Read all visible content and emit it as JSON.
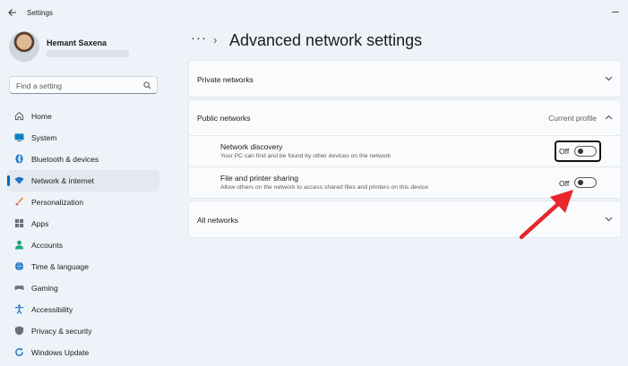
{
  "window": {
    "title": "Settings"
  },
  "profile": {
    "name": "Hemant Saxena"
  },
  "search": {
    "placeholder": "Find a setting"
  },
  "sidebar": {
    "items": [
      {
        "label": "Home",
        "icon": "home-icon"
      },
      {
        "label": "System",
        "icon": "monitor-icon"
      },
      {
        "label": "Bluetooth & devices",
        "icon": "bluetooth-icon"
      },
      {
        "label": "Network & internet",
        "icon": "wifi-icon",
        "active": true
      },
      {
        "label": "Personalization",
        "icon": "brush-icon"
      },
      {
        "label": "Apps",
        "icon": "apps-icon"
      },
      {
        "label": "Accounts",
        "icon": "person-icon"
      },
      {
        "label": "Time & language",
        "icon": "globe-icon"
      },
      {
        "label": "Gaming",
        "icon": "controller-icon"
      },
      {
        "label": "Accessibility",
        "icon": "accessibility-icon"
      },
      {
        "label": "Privacy & security",
        "icon": "shield-icon"
      },
      {
        "label": "Windows Update",
        "icon": "update-icon"
      }
    ]
  },
  "header": {
    "breadcrumb_more": "···",
    "breadcrumb_sep": "›",
    "title": "Advanced network settings"
  },
  "sections": {
    "private": {
      "label": "Private networks"
    },
    "public": {
      "label": "Public networks",
      "badge": "Current profile",
      "settings": [
        {
          "title": "Network discovery",
          "description": "Your PC can find and be found by other devices on the network",
          "state": "Off"
        },
        {
          "title": "File and printer sharing",
          "description": "Allow others on the network to access shared files and printers on this device",
          "state": "Off"
        }
      ]
    },
    "all": {
      "label": "All networks"
    }
  },
  "colors": {
    "accent": "#0067c0",
    "arrow": "#e8262b",
    "background": "#eef3f9"
  }
}
